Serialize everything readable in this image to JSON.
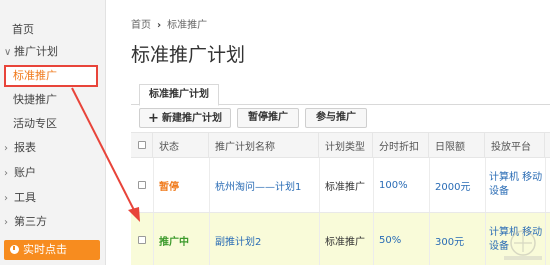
{
  "sidebar": {
    "home": "首页",
    "group_promo": "推广计划",
    "item_standard": "标准推广",
    "item_quick": "快捷推广",
    "item_activity": "活动专区",
    "group_reports": "报表",
    "group_account": "账户",
    "group_tools": "工具",
    "group_third": "第三方",
    "cta": "实时点击"
  },
  "breadcrumb": {
    "home": "首页",
    "separator": "›",
    "current": "标准推广"
  },
  "page_title": "标准推广计划",
  "tab_label": "标准推广计划",
  "toolbar": {
    "new_label": "新建推广计划",
    "pause_label": "暂停推广",
    "join_label": "参与推广"
  },
  "table": {
    "headers": {
      "status": "状态",
      "name": "推广计划名称",
      "type": "计划类型",
      "discount": "分时折扣",
      "limit": "日限额",
      "platform": "投放平台"
    },
    "rows": [
      {
        "status": "暂停",
        "name": "杭州淘问——计划1",
        "type": "标准推广",
        "discount": "100%",
        "limit": "2000元",
        "platform": "计算机 移动设备"
      },
      {
        "status": "推广中",
        "name": "副推计划2",
        "type": "标准推广",
        "discount": "50%",
        "limit": "300元",
        "platform": "计算机 移动设备"
      }
    ]
  },
  "colors": {
    "accent_orange": "#f78c1f",
    "status_pause": "#f07b1d",
    "status_active": "#3c9a2c",
    "link_blue": "#2a6cb5",
    "highlight_row": "#f9fbd9",
    "annotation_red": "#e8443a"
  }
}
